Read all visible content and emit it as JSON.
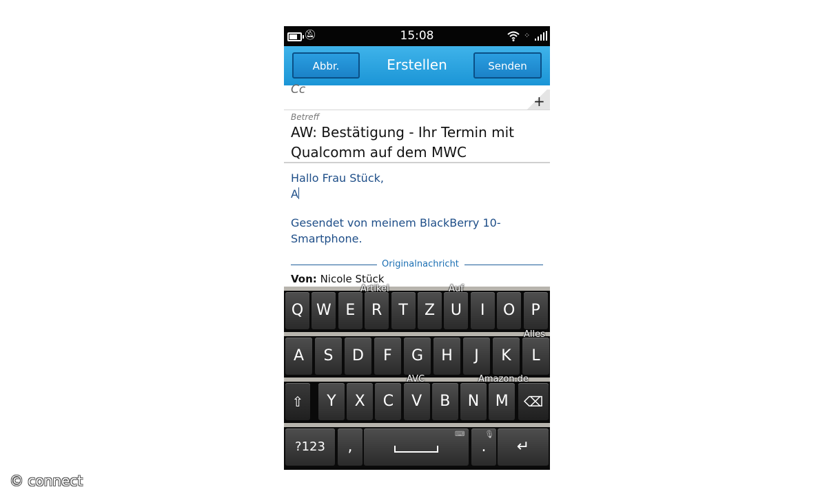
{
  "status_bar": {
    "time": "15:08"
  },
  "title_bar": {
    "cancel_label": "Abbr.",
    "title": "Erstellen",
    "send_label": "Senden"
  },
  "compose": {
    "cc_label": "Cc",
    "subject_label": "Betreff",
    "subject_line1": "AW: Bestätigung - Ihr Termin mit",
    "subject_line2": "Qualcomm auf dem MWC",
    "body_greeting": "Hallo Frau Stück,",
    "body_typed": "A",
    "signature_line1": "Gesendet von meinem BlackBerry 10-",
    "signature_line2": "Smartphone.",
    "original_header": "Originalnachricht",
    "from_label": "Von:",
    "from_value": "Nicole Stück"
  },
  "keyboard": {
    "row1": [
      "Q",
      "W",
      "E",
      "R",
      "T",
      "Z",
      "U",
      "I",
      "O",
      "P"
    ],
    "row2": [
      "A",
      "S",
      "D",
      "F",
      "G",
      "H",
      "J",
      "K",
      "L"
    ],
    "row3": [
      "Y",
      "X",
      "C",
      "V",
      "B",
      "N",
      "M"
    ],
    "symbols_label": "?123",
    "comma": ",",
    "period": ".",
    "predictions": {
      "artikel": "Artikel",
      "auf": "Auf",
      "alles": "Alles",
      "avc": "AVC",
      "amazon": "Amazon.de"
    },
    "icons": {
      "shift": "shift-icon",
      "backspace": "backspace-icon",
      "enter": "enter-icon",
      "mic": "microphone-icon",
      "keyboard": "keyboard-icon",
      "space": "space-icon"
    }
  },
  "watermark": "© connect",
  "colors": {
    "title_bar": "#1b95d6",
    "body_text": "#1e4e88",
    "keyboard_bg": "#0a0a0a"
  }
}
